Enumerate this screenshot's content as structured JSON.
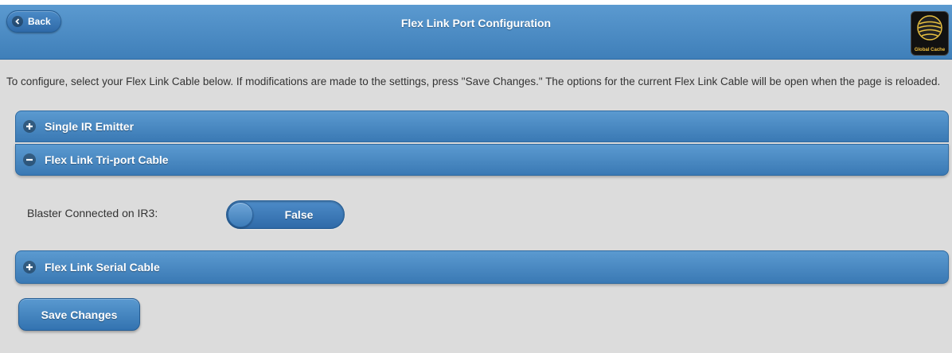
{
  "header": {
    "back_label": "Back",
    "title": "Flex Link Port Configuration",
    "logo_text": "Global Cache"
  },
  "intro_text": "To configure, select your Flex Link Cable below. If modifications are made to the settings, press \"Save Changes.\" The options for the current Flex Link Cable will be open when the page is reloaded.",
  "sections": [
    {
      "label": "Single IR Emitter",
      "state": "collapsed",
      "icon": "plus-icon"
    },
    {
      "label": "Flex Link Tri-port Cable",
      "state": "expanded",
      "icon": "minus-icon"
    },
    {
      "label": "Flex Link Serial Cable",
      "state": "collapsed",
      "icon": "plus-icon"
    }
  ],
  "triport": {
    "field_label": "Blaster Connected on IR3:",
    "toggle_value": "False"
  },
  "save_label": "Save Changes",
  "colors": {
    "accent": "#3f7fb9",
    "background": "#dcdcdc"
  }
}
